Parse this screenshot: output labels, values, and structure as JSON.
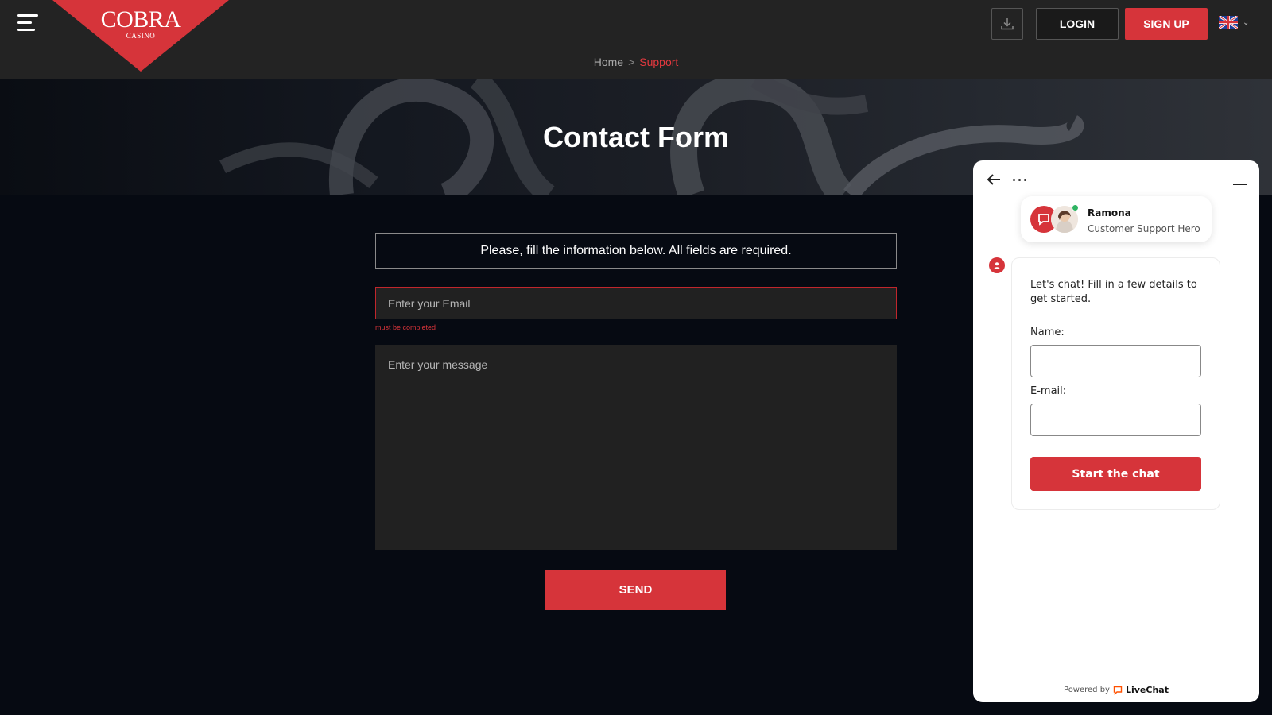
{
  "header": {
    "logo_text": "COBRA",
    "logo_sub": "CASINO",
    "login_label": "LOGIN",
    "signup_label": "SIGN UP",
    "language_icon": "uk-flag-icon",
    "download_icon": "download-icon",
    "menu_icon": "hamburger-menu-icon"
  },
  "breadcrumb": {
    "home": "Home",
    "separator": ">",
    "current": "Support"
  },
  "hero": {
    "title": "Contact Form"
  },
  "form": {
    "info_text": "Please, fill the information below. All fields are required.",
    "email_placeholder": "Enter your Email",
    "email_error": "must be completed",
    "message_placeholder": "Enter your message",
    "send_label": "SEND"
  },
  "chat": {
    "agent_name": "Ramona",
    "agent_role": "Customer Support Hero",
    "intro": "Let's chat! Fill in a few details to get started.",
    "name_label": "Name:",
    "email_label": "E-mail:",
    "start_label": "Start the chat",
    "powered_by": "Powered by",
    "brand": "LiveChat"
  },
  "colors": {
    "accent": "#d6343a",
    "header_bg": "#232323",
    "page_bg": "#060a12",
    "input_bg": "#212121",
    "online": "#2fb463"
  }
}
